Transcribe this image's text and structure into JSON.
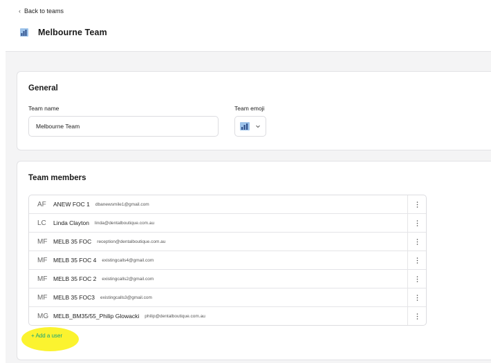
{
  "nav": {
    "back_label": "Back to teams"
  },
  "page": {
    "title": "Melbourne Team",
    "team_icon": "bar-chart-emoji-icon"
  },
  "general": {
    "heading": "General",
    "team_name_label": "Team name",
    "team_name_value": "Melbourne Team",
    "team_emoji_label": "Team emoji",
    "team_emoji_icon": "bar-chart-emoji-icon"
  },
  "members": {
    "heading": "Team members",
    "items": [
      {
        "initials": "AF",
        "name": "ANEW FOC 1",
        "email": "dbanewsmile1@gmail.com"
      },
      {
        "initials": "LC",
        "name": "Linda Clayton",
        "email": "linda@dentalboutique.com.au"
      },
      {
        "initials": "MF",
        "name": "MELB 35 FOC",
        "email": "reception@dentalboutique.com.au"
      },
      {
        "initials": "MF",
        "name": "MELB 35 FOC 4",
        "email": "existingcalls4@gmail.com"
      },
      {
        "initials": "MF",
        "name": "MELB 35 FOC 2",
        "email": "existingcalls2@gmail.com"
      },
      {
        "initials": "MF",
        "name": "MELB 35 FOC3",
        "email": "existingcalls3@gmail.com"
      },
      {
        "initials": "MG",
        "name": "MELB_BM35/55_Philip Glowacki",
        "email": "philip@dentalboutique.com.au"
      }
    ],
    "add_user_label": "+ Add a user"
  },
  "colors": {
    "accent": "#13a37a",
    "highlight": "#fbf32f",
    "background": "#f4f4f5"
  }
}
